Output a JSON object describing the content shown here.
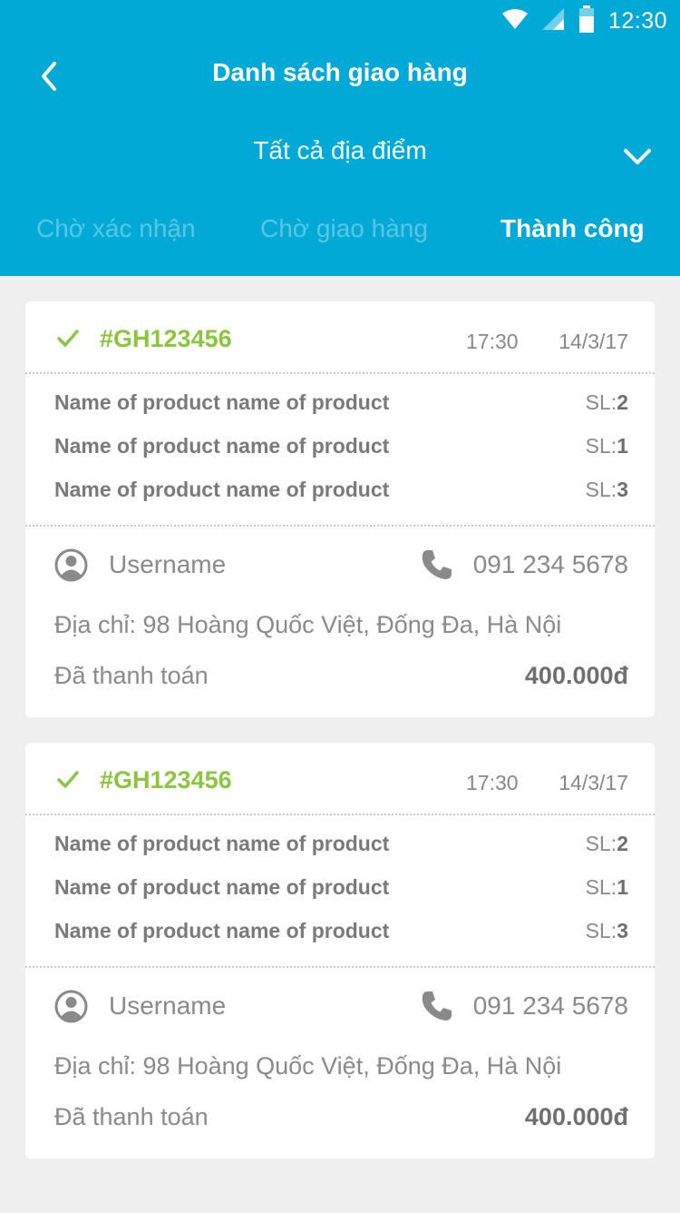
{
  "status_bar": {
    "time": "12:30",
    "icons": [
      "wifi-icon",
      "signal-icon",
      "battery-icon"
    ]
  },
  "header": {
    "title": "Danh sách giao hàng",
    "back_icon": "chevron-left-icon",
    "location": "Tất cả địa điểm",
    "location_icon": "chevron-down-icon"
  },
  "tabs": [
    {
      "label": "Chờ xác nhận",
      "active": false
    },
    {
      "label": "Chờ giao hàng",
      "active": false
    },
    {
      "label": "Thành công",
      "active": true
    }
  ],
  "colors": {
    "header_bg": "#00a9d6",
    "success_green": "#8cc63f",
    "page_bg": "#efefef"
  },
  "orders": [
    {
      "id": "#GH123456",
      "time": "17:30",
      "date": "14/3/17",
      "items": [
        {
          "name": "Name of product name of product",
          "qty_label": "SL:",
          "qty": "2"
        },
        {
          "name": "Name of product name of product",
          "qty_label": "SL:",
          "qty": "1"
        },
        {
          "name": "Name of product name of product",
          "qty_label": "SL:",
          "qty": "3"
        }
      ],
      "username": "Username",
      "phone": "091 234 5678",
      "address": "Địa chỉ: 98 Hoàng Quốc Việt, Đống Đa, Hà Nội",
      "payment_status": "Đã thanh toán",
      "amount": "400.000đ"
    },
    {
      "id": "#GH123456",
      "time": "17:30",
      "date": "14/3/17",
      "items": [
        {
          "name": "Name of product name of product",
          "qty_label": "SL:",
          "qty": "2"
        },
        {
          "name": "Name of product name of product",
          "qty_label": "SL:",
          "qty": "1"
        },
        {
          "name": "Name of product name of product",
          "qty_label": "SL:",
          "qty": "3"
        }
      ],
      "username": "Username",
      "phone": "091 234 5678",
      "address": "Địa chỉ: 98 Hoàng Quốc Việt, Đống Đa, Hà Nội",
      "payment_status": "Đã thanh toán",
      "amount": "400.000đ"
    }
  ]
}
